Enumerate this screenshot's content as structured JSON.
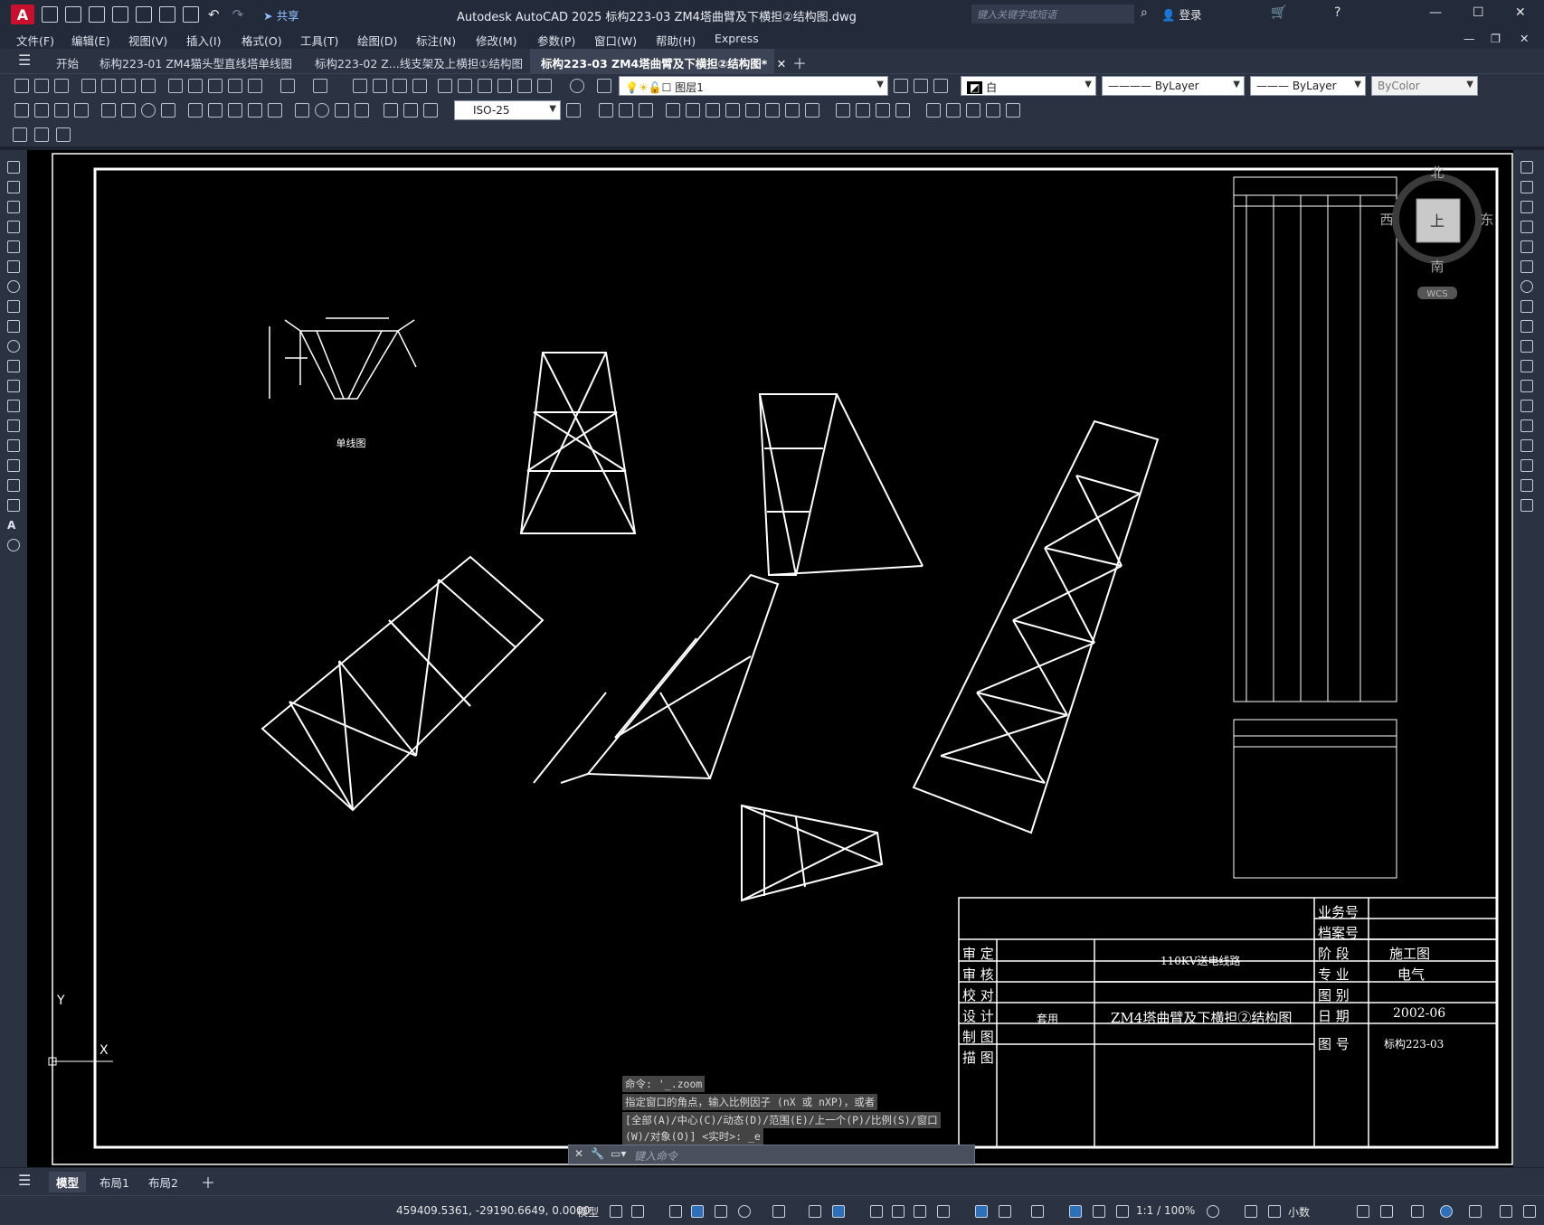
{
  "app": {
    "logo": "A",
    "title": "Autodesk AutoCAD 2025    标构223-03 ZM4塔曲臂及下横担②结构图.dwg",
    "share": "共享",
    "search_placeholder": "键入关键字或短语",
    "login": "登录"
  },
  "menu": [
    "文件(F)",
    "编辑(E)",
    "视图(V)",
    "插入(I)",
    "格式(O)",
    "工具(T)",
    "绘图(D)",
    "标注(N)",
    "修改(M)",
    "参数(P)",
    "窗口(W)",
    "帮助(H)",
    "Express"
  ],
  "doc_tabs": {
    "start": "开始",
    "tabs": [
      "标构223-01 ZM4猫头型直线塔单线图",
      "标构223-02 Z...线支架及上横担①结构图",
      "标构223-03 ZM4塔曲臂及下横担②结构图*"
    ]
  },
  "toolbar": {
    "layer": "图层1",
    "color": "白",
    "linetype": "ByLayer",
    "lineweight": "ByLayer",
    "plotstyle": "ByColor",
    "dimstyle": "ISO-25"
  },
  "viewcube": {
    "north": "北",
    "south": "南",
    "east": "东",
    "west": "西",
    "top": "上",
    "wcs": "WCS"
  },
  "drawing": {
    "single_line_label": "单线图",
    "axis_y": "Y",
    "axis_x": "X"
  },
  "title_block": {
    "business_no": "业务号",
    "archive_no": "档案号",
    "stage_label": "阶  段",
    "stage_value": "施工图",
    "major_label": "专  业",
    "major_value": "电气",
    "category_label": "图  别",
    "date_label": "日  期",
    "date_value": "2002-06",
    "drawing_no_label": "图  号",
    "drawing_no_value": "标构223-03",
    "approve": "审  定",
    "review": "审  核",
    "check": "校  对",
    "design": "设  计",
    "draft": "制  图",
    "trace": "描  图",
    "project": "110KV送电线路",
    "reuse": "套用",
    "drawing_name": "ZM4塔曲臂及下横担②结构图"
  },
  "command": {
    "line1": "命令: '_.zoom",
    "line2": "指定窗口的角点，输入比例因子 (nX 或 nXP)，或者",
    "line3": "[全部(A)/中心(C)/动态(D)/范围(E)/上一个(P)/比例(S)/窗口",
    "line4": "(W)/对象(O)] <实时>: _e",
    "input_placeholder": "键入命令"
  },
  "layout_tabs": [
    "模型",
    "布局1",
    "布局2"
  ],
  "status": {
    "coords": "459409.5361, -29190.6649, 0.0000",
    "model": "模型",
    "scale": "1:1 / 100%",
    "units": "小数"
  },
  "colors": {
    "background": "#000000",
    "chrome": "#2b3242",
    "logo": "#c8102e"
  }
}
